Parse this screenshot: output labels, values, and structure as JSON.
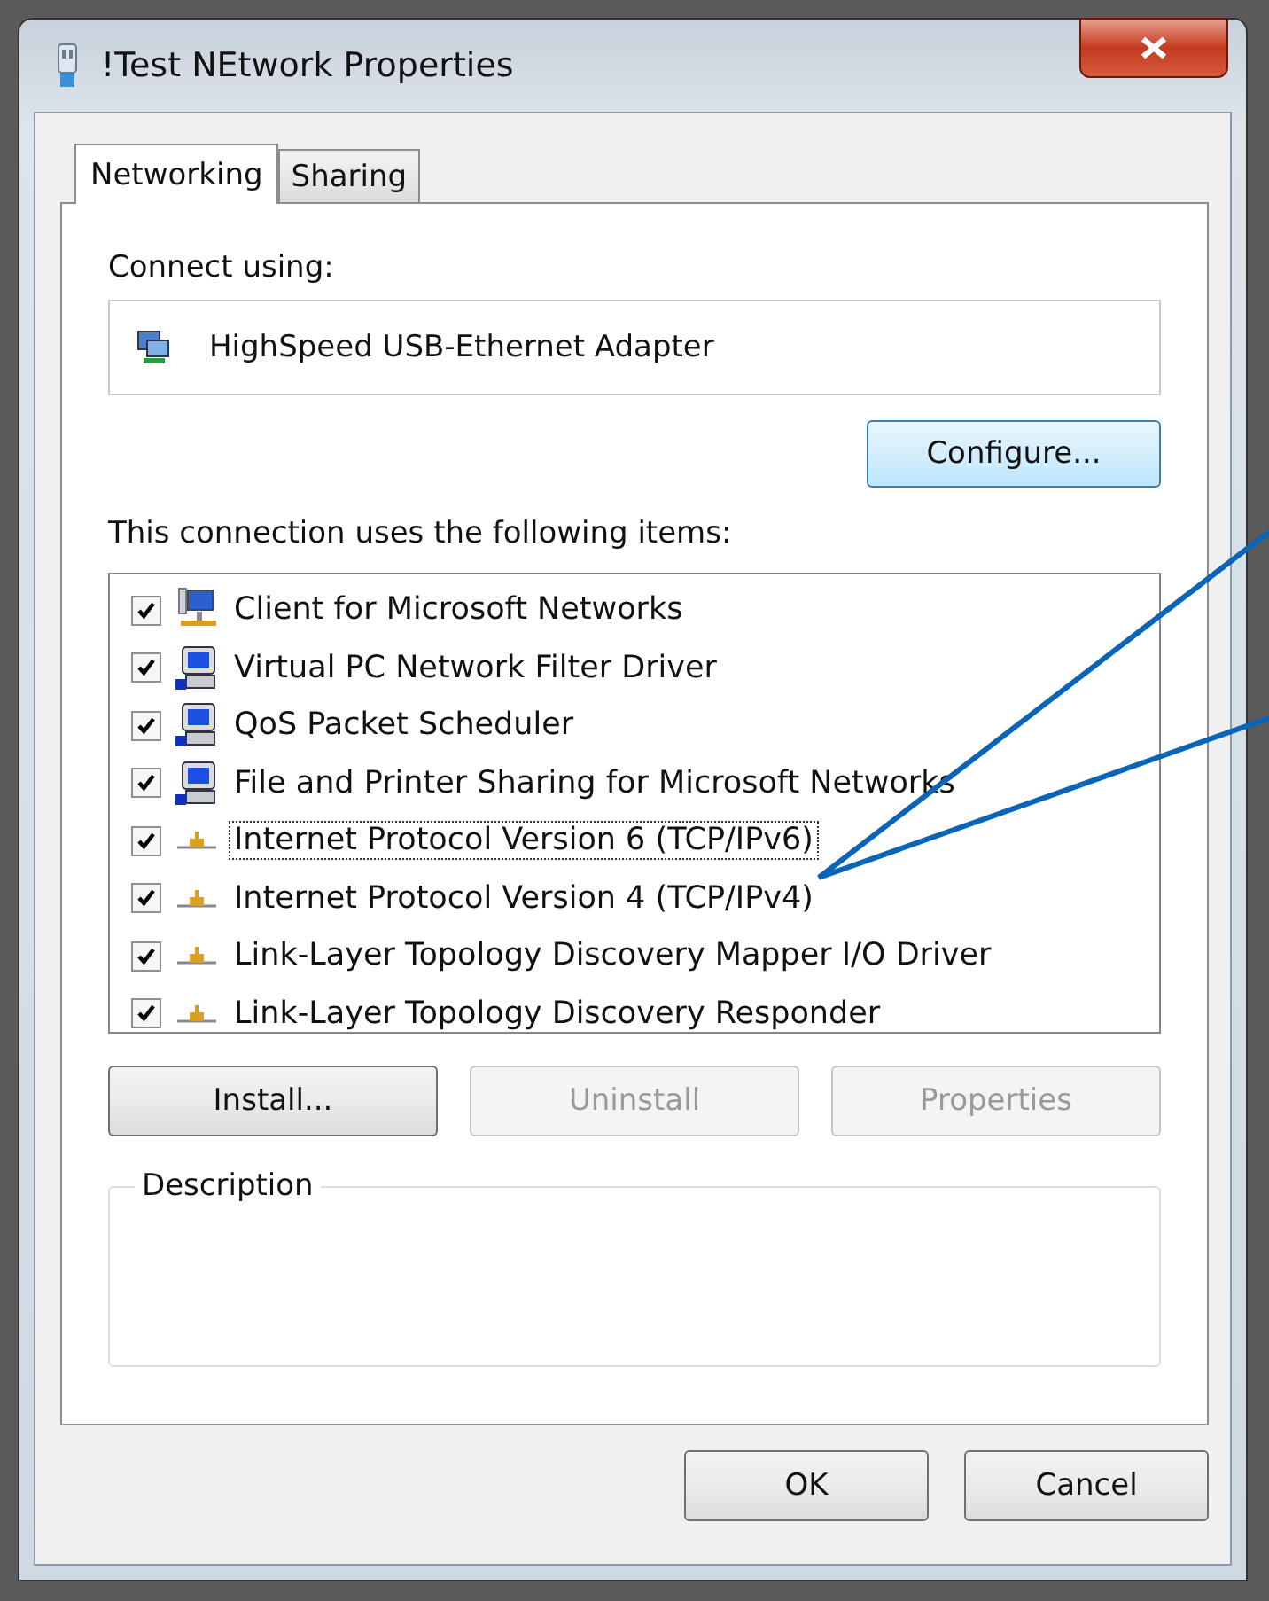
{
  "window": {
    "title": "!Test NEtwork Properties"
  },
  "tabs": [
    {
      "label": "Networking",
      "selected": true
    },
    {
      "label": "Sharing",
      "selected": false
    }
  ],
  "connect_using": {
    "label": "Connect using:",
    "adapter": "HighSpeed USB-Ethernet Adapter",
    "configure_button": "Configure..."
  },
  "items_label": "This connection uses the following items:",
  "items": [
    {
      "kind": "client",
      "label": "Client for Microsoft Networks",
      "checked": true,
      "focused": false
    },
    {
      "kind": "service",
      "label": "Virtual PC Network Filter Driver",
      "checked": true,
      "focused": false
    },
    {
      "kind": "service",
      "label": "QoS Packet Scheduler",
      "checked": true,
      "focused": false
    },
    {
      "kind": "service",
      "label": "File and Printer Sharing for Microsoft Networks",
      "checked": true,
      "focused": false
    },
    {
      "kind": "protocol",
      "label": "Internet Protocol Version 6 (TCP/IPv6)",
      "checked": true,
      "focused": true
    },
    {
      "kind": "protocol",
      "label": "Internet Protocol Version 4 (TCP/IPv4)",
      "checked": true,
      "focused": false
    },
    {
      "kind": "protocol",
      "label": "Link-Layer Topology Discovery Mapper I/O Driver",
      "checked": true,
      "focused": false
    },
    {
      "kind": "protocol",
      "label": "Link-Layer Topology Discovery Responder",
      "checked": true,
      "focused": false
    }
  ],
  "item_buttons": [
    {
      "label": "Install...",
      "disabled": false
    },
    {
      "label": "Uninstall",
      "disabled": true
    },
    {
      "label": "Properties",
      "disabled": true
    }
  ],
  "description": {
    "title": "Description"
  },
  "footer_buttons": [
    {
      "label": "OK"
    },
    {
      "label": "Cancel"
    }
  ]
}
